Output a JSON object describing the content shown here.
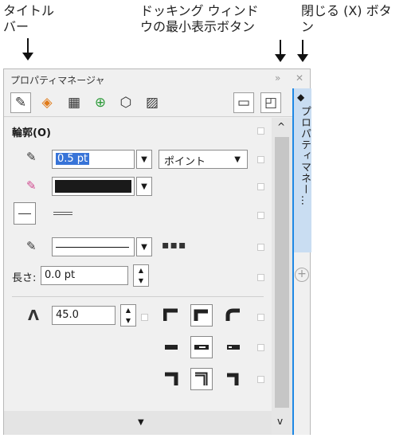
{
  "callouts": {
    "title_bar": "タイトル\nバー",
    "docking_minimize": "ドッキング ウィンド\nウの最小表示ボタン",
    "close_button": "閉じる (X) ボタ\nン"
  },
  "panel": {
    "title": "プロパティマネージャ",
    "side_tab_label": "プロパティマネー…",
    "section_title": "輪郭(O)",
    "width_value": "0.5 pt",
    "unit_value": "ポイント",
    "length_label": "長さ:",
    "length_value": "0.0 pt",
    "miter_value": "45.0"
  },
  "colors": {
    "accent": "#1e88e5",
    "outline_swatch": "#1a1a1a",
    "tab_bg": "#c9ddf2"
  },
  "icons": {
    "title_docking": "double-chevron-right-icon",
    "title_close": "close-icon",
    "tools": [
      "outline-pen-icon",
      "fill-icon",
      "transparency-icon",
      "effects-icon",
      "shape-icon",
      "image-icon",
      "frame-icon",
      "preview-icon"
    ]
  }
}
